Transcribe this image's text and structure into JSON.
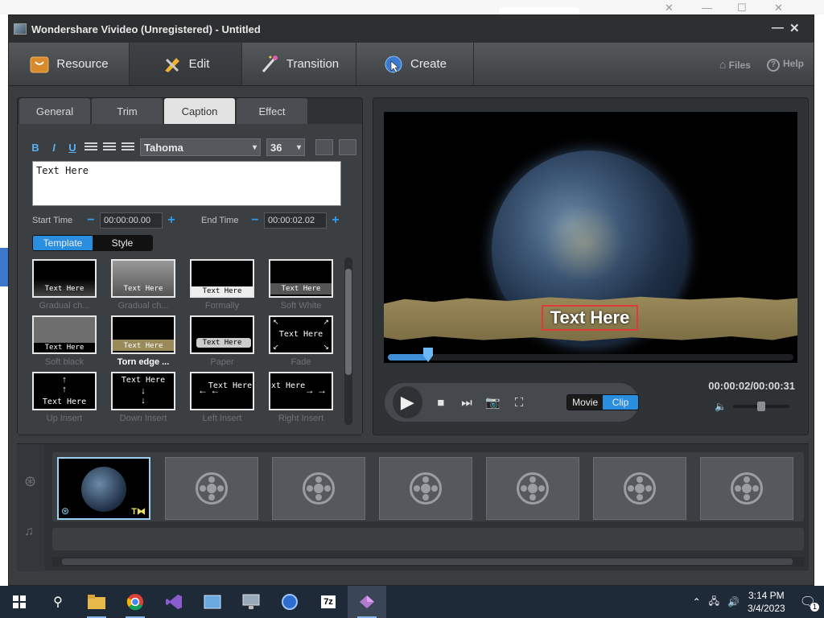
{
  "window": {
    "title": "Wondershare Vivideo (Unregistered) - Untitled"
  },
  "toolbar": {
    "tabs": [
      {
        "label": "Resource",
        "icon": "box-icon"
      },
      {
        "label": "Edit",
        "icon": "pencil-icon"
      },
      {
        "label": "Transition",
        "icon": "wand-icon"
      },
      {
        "label": "Create",
        "icon": "globe-cursor-icon"
      }
    ],
    "files_label": "Files",
    "help_label": "Help"
  },
  "editor": {
    "tabs": [
      "General",
      "Trim",
      "Caption",
      "Effect"
    ],
    "active_tab": "Caption",
    "format": {
      "bold": "B",
      "italic": "I",
      "underline": "U"
    },
    "font": "Tahoma",
    "size": "36",
    "text": "Text Here",
    "start_label": "Start Time",
    "start_time": "00:00:00.00",
    "end_label": "End Time",
    "end_time": "00:00:02.02",
    "seg": {
      "template": "Template",
      "style": "Style"
    },
    "templates": [
      {
        "name": "Gradual ch...",
        "text": "Text Here"
      },
      {
        "name": "Gradual ch...",
        "text": "Text Here"
      },
      {
        "name": "Formally",
        "text": "Text Here"
      },
      {
        "name": "Soft White",
        "text": "Text Here"
      },
      {
        "name": "Soft black",
        "text": "Text Here"
      },
      {
        "name": "Torn edge ...",
        "text": "Text Here"
      },
      {
        "name": "Paper",
        "text": "Text Here"
      },
      {
        "name": "Fade",
        "text": "Text Here"
      },
      {
        "name": "Up Insert",
        "text": "Text Here"
      },
      {
        "name": "Down Insert",
        "text": "Text Here"
      },
      {
        "name": "Left Insert",
        "text": "Text Here"
      },
      {
        "name": "Right Insert",
        "text": "Text Here"
      }
    ]
  },
  "preview": {
    "caption": "Text Here",
    "timecode": "00:00:02/00:00:31",
    "progress": 0.08,
    "movie_label": "Movie",
    "clip_label": "Clip"
  },
  "taskbar": {
    "time": "3:14 PM",
    "date": "3/4/2023",
    "notif_count": "1"
  }
}
